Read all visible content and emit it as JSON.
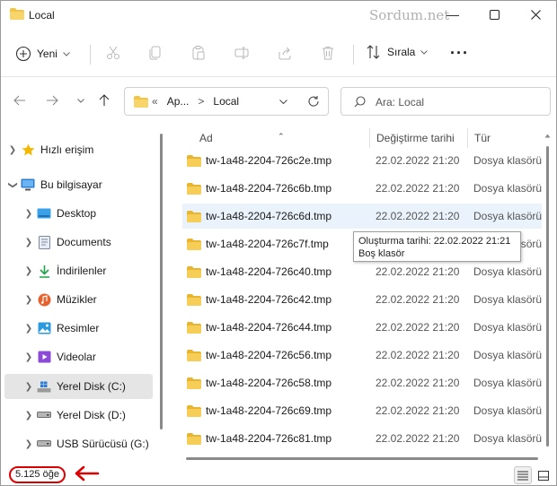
{
  "window": {
    "title": "Local",
    "watermark": "Sordum.net",
    "minimize_glyph": "—",
    "maximize_glyph": "☐",
    "close_glyph": "✕"
  },
  "toolbar": {
    "new_label": "Yeni",
    "sort_label": "Sırala",
    "more_label": "···"
  },
  "address": {
    "chevrons": "«",
    "crumb1": "Ap...",
    "crumb_sep": ">",
    "crumb2": "Local"
  },
  "search": {
    "placeholder": "Ara: Local"
  },
  "sidebar": {
    "items": [
      {
        "label": "Hızlı erişim",
        "icon": "star-icon",
        "color": "#f5b800"
      },
      {
        "label": "Bu bilgisayar",
        "icon": "computer-icon",
        "color": "#2b7cd3"
      },
      {
        "label": "Desktop",
        "icon": "desktop-icon",
        "color": "#3aa0e8"
      },
      {
        "label": "Documents",
        "icon": "documents-icon",
        "color": "#7a8aa0"
      },
      {
        "label": "İndirilenler",
        "icon": "download-icon",
        "color": "#1fa34a"
      },
      {
        "label": "Müzikler",
        "icon": "music-icon",
        "color": "#e8602c"
      },
      {
        "label": "Resimler",
        "icon": "pictures-icon",
        "color": "#2b9be0"
      },
      {
        "label": "Videolar",
        "icon": "videos-icon",
        "color": "#8c4bd6"
      },
      {
        "label": "Yerel Disk (C:)",
        "icon": "windows-drive-icon",
        "color": "#2b7cd3"
      },
      {
        "label": "Yerel Disk (D:)",
        "icon": "drive-icon",
        "color": "#777777"
      },
      {
        "label": "USB Sürücüsü (G:)",
        "icon": "usb-drive-icon",
        "color": "#777777"
      }
    ]
  },
  "columns": {
    "name": "Ad",
    "modified": "Değiştirme tarihi",
    "type": "Tür"
  },
  "files": [
    {
      "name": "tw-1a48-2204-726c2e.tmp",
      "date": "22.02.2022 21:20",
      "type": "Dosya klasörü"
    },
    {
      "name": "tw-1a48-2204-726c6b.tmp",
      "date": "22.02.2022 21:20",
      "type": "Dosya klasörü"
    },
    {
      "name": "tw-1a48-2204-726c6d.tmp",
      "date": "22.02.2022 21:20",
      "type": "Dosya klasörü"
    },
    {
      "name": "tw-1a48-2204-726c7f.tmp",
      "date": "",
      "type": "Dosya klasörü"
    },
    {
      "name": "tw-1a48-2204-726c40.tmp",
      "date": "22.02.2022 21:20",
      "type": "Dosya klasörü"
    },
    {
      "name": "tw-1a48-2204-726c42.tmp",
      "date": "22.02.2022 21:20",
      "type": "Dosya klasörü"
    },
    {
      "name": "tw-1a48-2204-726c44.tmp",
      "date": "22.02.2022 21:20",
      "type": "Dosya klasörü"
    },
    {
      "name": "tw-1a48-2204-726c56.tmp",
      "date": "22.02.2022 21:20",
      "type": "Dosya klasörü"
    },
    {
      "name": "tw-1a48-2204-726c58.tmp",
      "date": "22.02.2022 21:20",
      "type": "Dosya klasörü"
    },
    {
      "name": "tw-1a48-2204-726c69.tmp",
      "date": "22.02.2022 21:20",
      "type": "Dosya klasörü"
    },
    {
      "name": "tw-1a48-2204-726c81.tmp",
      "date": "22.02.2022 21:20",
      "type": "Dosya klasörü"
    }
  ],
  "tooltip": {
    "line1": "Oluşturma tarihi: 22.02.2022 21:21",
    "line2": "Boş klasör"
  },
  "status": {
    "item_count": "5.125 öğe"
  },
  "colors": {
    "folder": "#f4c542",
    "accent": "#0067c0",
    "highlight": "#eaf3fc",
    "annotation": "#dd0000"
  }
}
